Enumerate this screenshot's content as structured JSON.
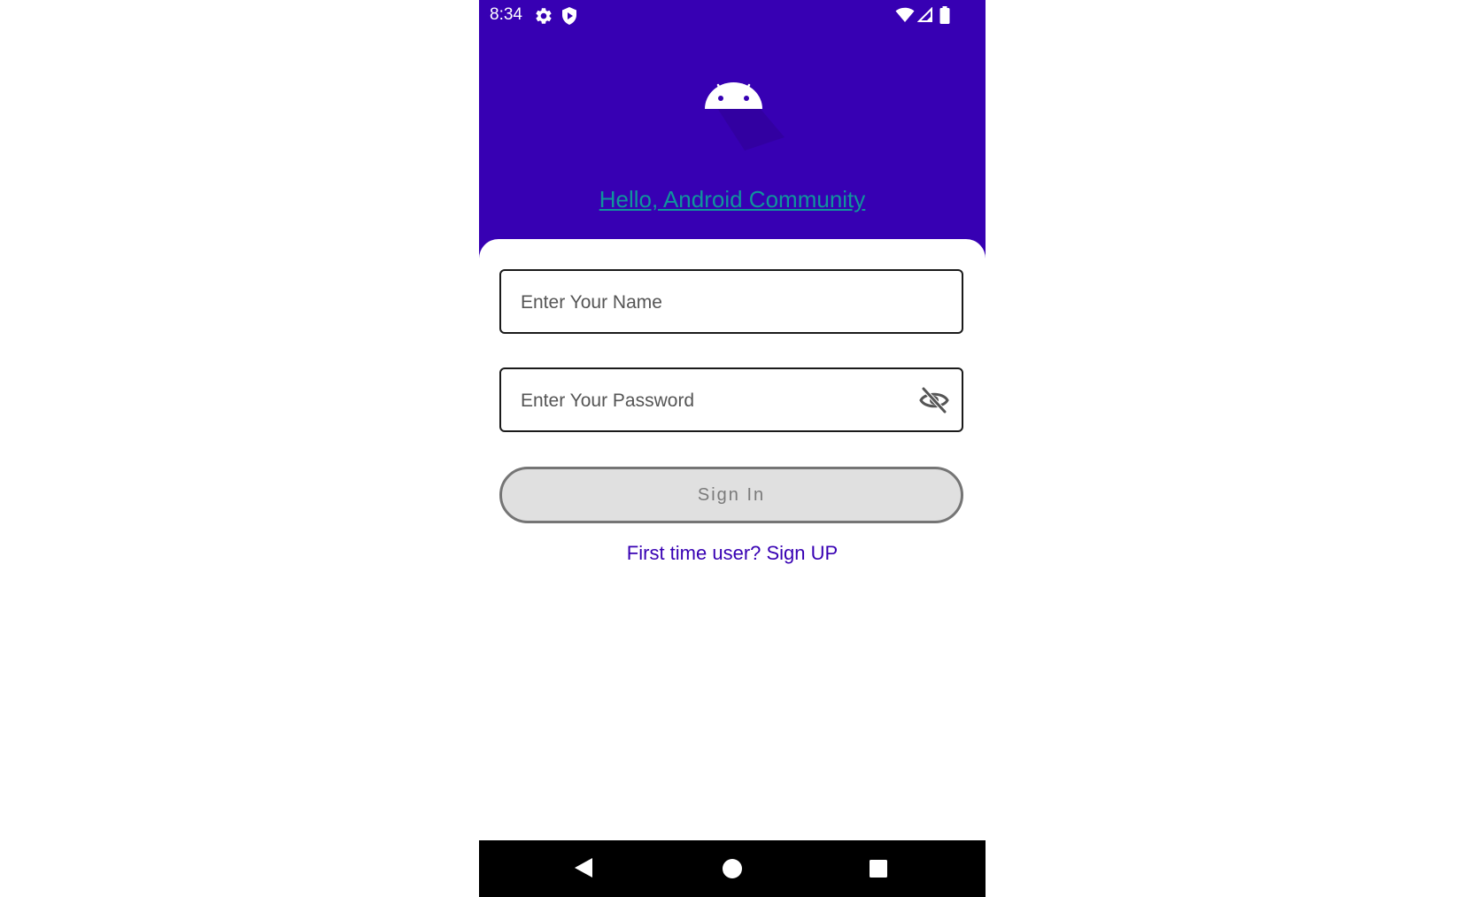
{
  "status_bar": {
    "time": "8:34",
    "left_icons": [
      "gear-icon",
      "shield-icon"
    ],
    "right_icons": [
      "wifi-icon",
      "signal-icon",
      "battery-icon"
    ]
  },
  "header": {
    "logo_icon": "android-icon",
    "greeting": "Hello, Android Community",
    "background_color": "#3700b3",
    "greeting_color": "#10949b"
  },
  "form": {
    "name_placeholder": "Enter Your Name",
    "name_value": "",
    "password_placeholder": "Enter Your Password",
    "password_value": "",
    "password_toggle_icon": "eye-off-icon",
    "sign_in_label": "Sign In",
    "sign_up_text": "First time user? Sign UP"
  },
  "nav_bar": {
    "buttons": [
      "back-icon",
      "home-icon",
      "recents-icon"
    ]
  }
}
